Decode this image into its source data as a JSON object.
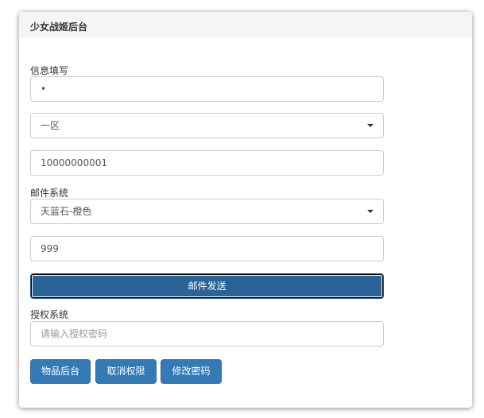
{
  "panel": {
    "title": "少女战姬后台"
  },
  "info_section": {
    "label": "信息填写",
    "input_value": "•",
    "server_select": "一区",
    "id_input": "10000000001"
  },
  "mail_section": {
    "label": "邮件系统",
    "item_select": "天蓝石-橙色",
    "quantity_input": "999",
    "send_button": "邮件发送"
  },
  "auth_section": {
    "label": "授权系统",
    "password_placeholder": "请输入授权密码",
    "buttons": {
      "items_admin": "物品后台",
      "revoke": "取消权限",
      "change_password": "修改密码"
    }
  },
  "colors": {
    "primary": "#337ab7",
    "primary_active": "#2a6496"
  },
  "icons": {
    "select_caret": "caret-down-icon"
  }
}
